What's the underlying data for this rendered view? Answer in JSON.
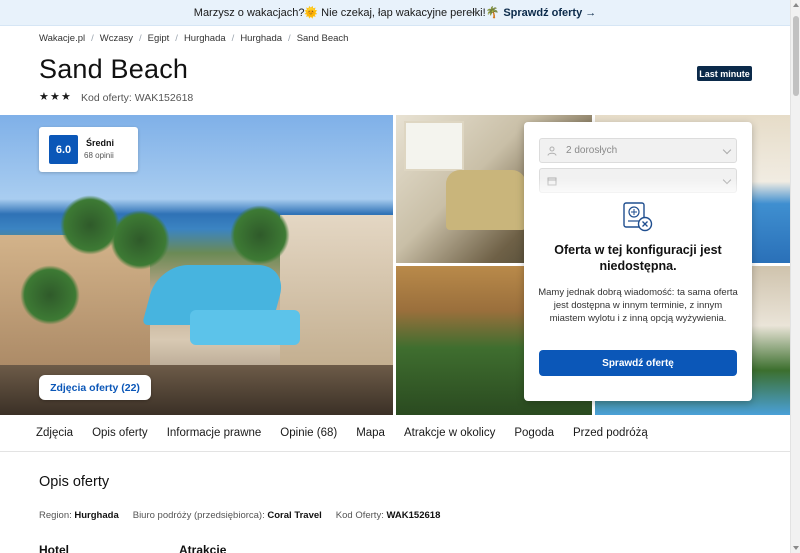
{
  "promo": {
    "text": "Marzysz o wakacjach?🌞 Nie czekaj, łap wakacyjne perełki!🌴",
    "link_label": "Sprawdź oferty",
    "arrow": "→"
  },
  "breadcrumb": [
    "Wakacje.pl",
    "Wczasy",
    "Egipt",
    "Hurghada",
    "Hurghada",
    "Sand Beach"
  ],
  "hotel": {
    "name": "Sand Beach",
    "stars": 3,
    "badge": "Last minute",
    "offer_code_label": "Kod oferty: WAK152618"
  },
  "rating": {
    "score": "6.0",
    "label": "Średni",
    "count": "68 opinii"
  },
  "gallery": {
    "photos_button": "Zdjęcia oferty (22)"
  },
  "booking": {
    "adults_value": "2 dorosłych",
    "date_value": "",
    "unavailable_title": "Oferta w tej konfiguracji jest niedostępna.",
    "unavailable_body": "Mamy jednak dobrą wiadomość: ta sama oferta jest dostępna w innym terminie, z innym miastem wylotu i z inną opcją wyżywienia.",
    "button_label": "Sprawdź ofertę"
  },
  "tabs": [
    "Zdjęcia",
    "Opis oferty",
    "Informacje prawne",
    "Opinie (68)",
    "Mapa",
    "Atrakcje w okolicy",
    "Pogoda",
    "Przed podróżą"
  ],
  "description": {
    "title": "Opis oferty",
    "region_label": "Region:",
    "region_value": "Hurghada",
    "agency_label": "Biuro podróży (przedsiębiorca):",
    "agency_value": "Coral Travel",
    "code_label": "Kod Oferty:",
    "code_value": "WAK152618",
    "hotel_heading": "Hotel",
    "attractions_heading": "Atrakcje"
  },
  "colors": {
    "primary": "#0b57b8",
    "badge_bg": "#0b2a4a",
    "promo_bg": "#e8f2fb"
  }
}
